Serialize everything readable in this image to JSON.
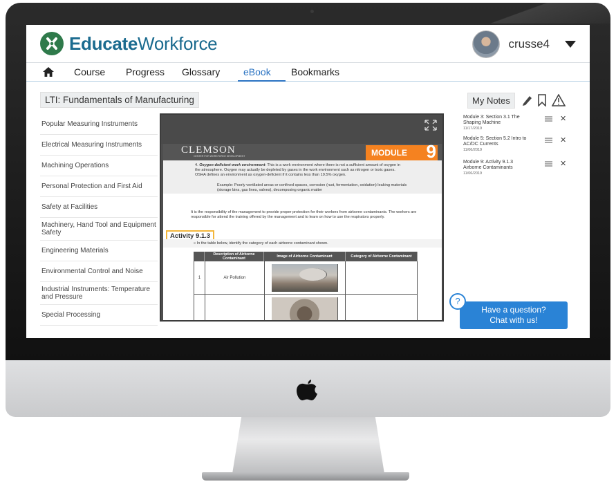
{
  "brand": {
    "name_bold": "Educate",
    "name_light": "Workforce",
    "accent": "#1b6b8f",
    "badge_color": "#2f7a4b"
  },
  "user": {
    "name": "crusse4"
  },
  "nav": {
    "items": [
      {
        "label": "Course"
      },
      {
        "label": "Progress"
      },
      {
        "label": "Glossary"
      },
      {
        "label": "eBook",
        "active": true
      },
      {
        "label": "Bookmarks"
      }
    ]
  },
  "course_title": "LTI: Fundamentals of Manufacturing",
  "sidebar": {
    "items": [
      {
        "label": "Popular Measuring Instruments"
      },
      {
        "label": "Electrical Measuring Instruments"
      },
      {
        "label": "Machining Operations"
      },
      {
        "label": "Personal Protection and First Aid"
      },
      {
        "label": "Safety at Facilities"
      },
      {
        "label": "Machinery, Hand Tool and Equipment Safety"
      },
      {
        "label": "Engineering Materials"
      },
      {
        "label": "Environmental Control and Noise"
      },
      {
        "label": "Industrial Instruments: Temperature and Pressure"
      },
      {
        "label": "Special Processing"
      }
    ]
  },
  "ebook": {
    "header_logo": "CLEMSON",
    "header_sub": "CENTER FOR WORKFORCE DEVELOPMENT",
    "module_label": "MODULE",
    "module_number": "9",
    "item4_bold": "Oxygen-deficient work environment",
    "item4_text": ": This is a work environment where there is not a sufficient amount of oxygen in the atmosphere. Oxygen may actually be depleted by gases in the work environment such as nitrogen or toxic gases. OSHA defines an environment as oxygen-deficient if it contains less than 19.5% oxygen.",
    "example_text": "Example: Poorly ventilated areas or confined spaces, corrosion (rust, fermentation, oxidation) leaking materials (storage bins, gas lines, valves), decomposing organic matter",
    "responsibility_text": "It is the responsibility of the management to provide proper protection for their workers from airborne contaminants. The workers are responsible for attend the training offered by the management and to learn on how to use the respirators properly.",
    "activity_label": "Activity 9.1.3",
    "instruction": "In the table below, identify the category of each airborne contaminant shown.",
    "table": {
      "headers": [
        "Description of Airborne Contaminant",
        "Image of Airborne Contaminant",
        "Category of Airborne Contaminant"
      ],
      "rows": [
        {
          "num": "1",
          "description": "Air Pollution"
        }
      ]
    }
  },
  "notes": {
    "label": "My Notes",
    "items": [
      {
        "title": "Module 3: Section 3.1 The Shaping Machine",
        "date": "11/17/2019"
      },
      {
        "title": "Module 5: Section 5.2 Intro to AC/DC Currents",
        "date": "11/06/2019"
      },
      {
        "title": "Module 9: Activity 9.1.3 Airborne Contaminants",
        "date": "11/06/2019"
      }
    ]
  },
  "chat": {
    "help_glyph": "?",
    "line1": "Have a question?",
    "line2": "Chat with us!",
    "color": "#2a83d6"
  }
}
